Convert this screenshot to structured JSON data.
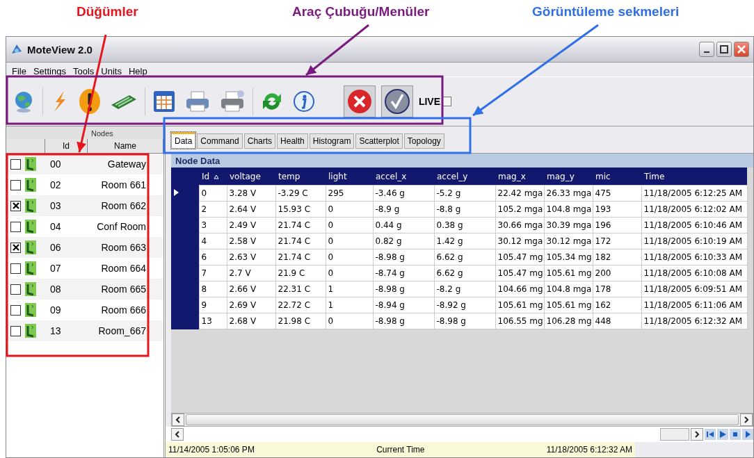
{
  "annotations": [
    {
      "text": "Düğümler",
      "color": "#e8141b"
    },
    {
      "text": "Araç Çubuğu/Menüler",
      "color": "#7b1a7e"
    },
    {
      "text": "Görüntüleme sekmeleri",
      "color": "#2f6fe8"
    }
  ],
  "window": {
    "title": "MoteView 2.0"
  },
  "menu": [
    "File",
    "Settings",
    "Tools",
    "Units",
    "Help"
  ],
  "toolbar": {
    "live_label": "LIVE",
    "live_checked": false
  },
  "nodes": {
    "title": "Nodes",
    "columns": [
      "Id",
      "Name"
    ],
    "rows": [
      {
        "checked": false,
        "id": "00",
        "name": "Gateway"
      },
      {
        "checked": false,
        "id": "02",
        "name": "Room 661"
      },
      {
        "checked": true,
        "id": "03",
        "name": "Room 662"
      },
      {
        "checked": false,
        "id": "04",
        "name": "Conf Room"
      },
      {
        "checked": true,
        "id": "06",
        "name": "Room 663"
      },
      {
        "checked": false,
        "id": "07",
        "name": "Room 664"
      },
      {
        "checked": false,
        "id": "08",
        "name": "Room 665"
      },
      {
        "checked": false,
        "id": "09",
        "name": "Room 666"
      },
      {
        "checked": false,
        "id": "13",
        "name": "Room_667"
      }
    ]
  },
  "tabs": [
    {
      "label": "Data",
      "selected": true
    },
    {
      "label": "Command",
      "selected": false
    },
    {
      "label": "Charts",
      "selected": false
    },
    {
      "label": "Health",
      "selected": false
    },
    {
      "label": "Histogram",
      "selected": false
    },
    {
      "label": "Scatterplot",
      "selected": false
    },
    {
      "label": "Topology",
      "selected": false
    }
  ],
  "node_data": {
    "title": "Node Data",
    "columns": [
      {
        "label": "Id",
        "sorted": true
      },
      {
        "label": "voltage",
        "sorted": false
      },
      {
        "label": "temp",
        "sorted": false
      },
      {
        "label": "light",
        "sorted": false
      },
      {
        "label": "accel_x",
        "sorted": false
      },
      {
        "label": "accel_y",
        "sorted": false
      },
      {
        "label": "mag_x",
        "sorted": false
      },
      {
        "label": "mag_y",
        "sorted": false
      },
      {
        "label": "mic",
        "sorted": false
      },
      {
        "label": "Time",
        "sorted": false
      }
    ],
    "rows": [
      {
        "current": true,
        "cells": [
          "0",
          "3.28 V",
          "-3.29 C",
          "295",
          "-3.46 g",
          "-5.2 g",
          "22.42 mga",
          "26.33 mga",
          "475",
          "11/18/2005 6:12:25 AM"
        ]
      },
      {
        "current": false,
        "cells": [
          "2",
          "2.64 V",
          "15.93 C",
          "0",
          "-8.9 g",
          "-8.8 g",
          "105.2 mga",
          "104.8 mga",
          "193",
          "11/18/2005 6:12:02 AM"
        ]
      },
      {
        "current": false,
        "cells": [
          "3",
          "2.49 V",
          "21.74 C",
          "0",
          "0.44 g",
          "0.38 g",
          "30.66 mga",
          "30.39 mga",
          "196",
          "11/18/2005 6:10:46 AM"
        ]
      },
      {
        "current": false,
        "cells": [
          "4",
          "2.58 V",
          "21.74 C",
          "0",
          "0.82 g",
          "1.42 g",
          "30.12 mga",
          "30.12 mga",
          "172",
          "11/18/2005 6:10:19 AM"
        ]
      },
      {
        "current": false,
        "cells": [
          "6",
          "2.63 V",
          "21.74 C",
          "0",
          "-8.98 g",
          "6.62 g",
          "105.47 mg",
          "105.34 mg",
          "182",
          "11/18/2005 6:10:33 AM"
        ]
      },
      {
        "current": false,
        "cells": [
          "7",
          "2.7 V",
          "21.9 C",
          "0",
          "-8.74 g",
          "6.62 g",
          "105.47 mg",
          "105.61 mg",
          "200",
          "11/18/2005 6:10:08 AM"
        ]
      },
      {
        "current": false,
        "cells": [
          "8",
          "2.66 V",
          "22.31 C",
          "1",
          "-8.98 g",
          "-8.2 g",
          "104.66 mg",
          "104.8 mga",
          "178",
          "11/18/2005 6:09:51 AM"
        ]
      },
      {
        "current": false,
        "cells": [
          "9",
          "2.69 V",
          "22.72 C",
          "1",
          "-8.94 g",
          "-8.92 g",
          "105.61 mg",
          "105.61 mg",
          "162",
          "11/18/2005 6:11:06 AM"
        ]
      },
      {
        "current": false,
        "cells": [
          "13",
          "2.68 V",
          "21.98 C",
          "0",
          "-8.98 g",
          "-8.98 g",
          "106.55 mg",
          "106.28 mg",
          "448",
          "11/18/2005 6:12:32 AM"
        ]
      }
    ]
  },
  "status_bar": {
    "start": "11/14/2005 1:05:06 PM",
    "label": "Current Time",
    "end": "11/18/2005 6:12:32 AM"
  }
}
